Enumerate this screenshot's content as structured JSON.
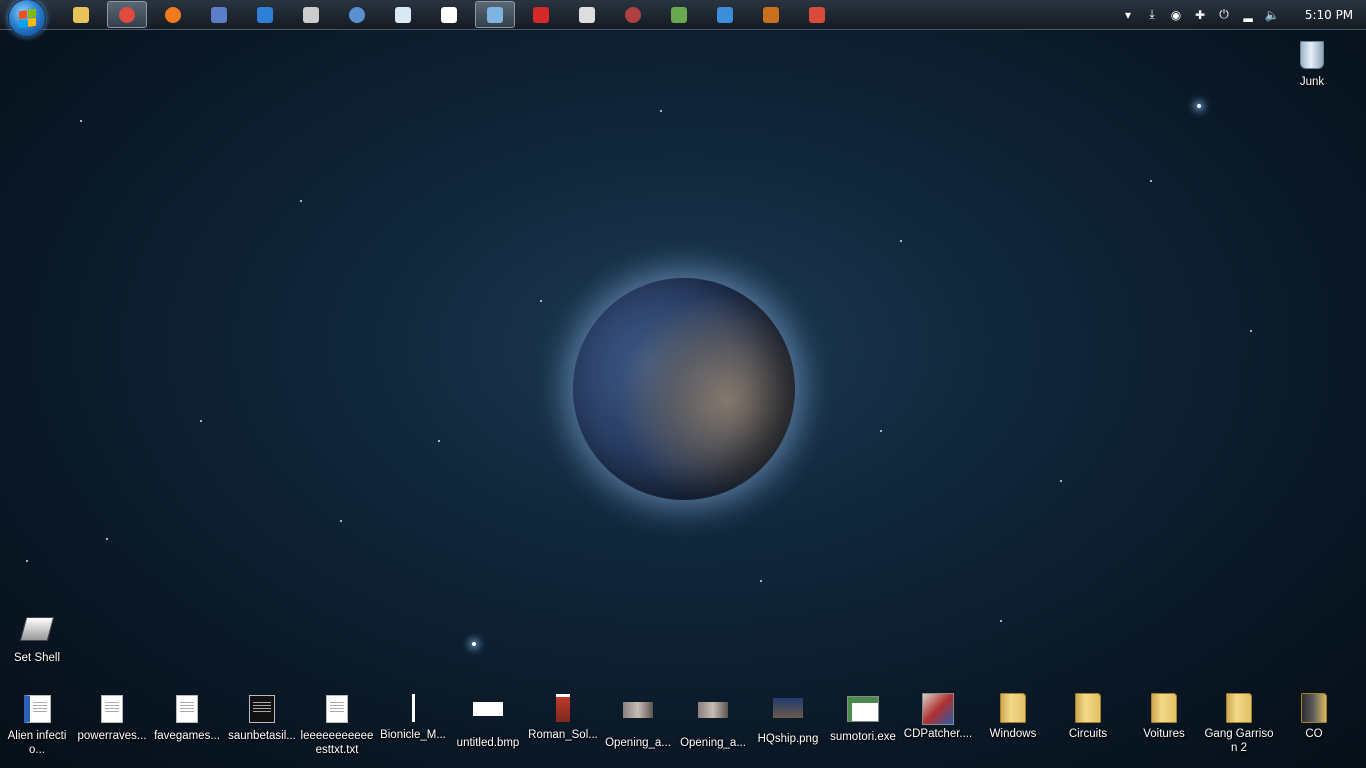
{
  "taskbar": {
    "start_button": "start-orb",
    "pinned": [
      {
        "name": "explorer",
        "color": "#e8c35a",
        "active": false
      },
      {
        "name": "chrome",
        "color": "#e04b3b",
        "active": true
      },
      {
        "name": "firefox",
        "color": "#f07a1e",
        "active": false
      },
      {
        "name": "document-viewer",
        "color": "#5a7fc8",
        "active": false
      },
      {
        "name": "photoshop-elements",
        "color": "#2f7fd6",
        "active": false
      },
      {
        "name": "game",
        "color": "#cccccc",
        "active": false
      },
      {
        "name": "globe",
        "color": "#5a8fd0",
        "active": false
      },
      {
        "name": "notepad",
        "color": "#d9e8f5",
        "active": false
      },
      {
        "name": "wordpad",
        "color": "#ffffff",
        "active": false
      },
      {
        "name": "steam-client",
        "color": "#7fb4e0",
        "active": true
      },
      {
        "name": "red-cross-app",
        "color": "#d62a2a",
        "active": false
      },
      {
        "name": "steam",
        "color": "#dddddd",
        "active": false
      },
      {
        "name": "disc-app",
        "color": "#b04040",
        "active": false
      },
      {
        "name": "minecraft",
        "color": "#6aa84f",
        "active": false
      },
      {
        "name": "3d-box",
        "color": "#3a8fd8",
        "active": false
      },
      {
        "name": "pcd",
        "color": "#c8701e",
        "active": false
      },
      {
        "name": "paint-app",
        "color": "#d84a3a",
        "active": false
      }
    ],
    "tray": [
      {
        "name": "show-hidden-icons",
        "glyph": "▾"
      },
      {
        "name": "download-tray",
        "glyph": "⤓"
      },
      {
        "name": "steam-tray",
        "glyph": "◉"
      },
      {
        "name": "red-cross-tray",
        "glyph": "✚"
      },
      {
        "name": "power-tray",
        "glyph": "⏻"
      },
      {
        "name": "network-tray",
        "glyph": "▂"
      },
      {
        "name": "volume-tray",
        "glyph": "🔈"
      }
    ],
    "clock": "5:10 PM"
  },
  "desktop": {
    "top_right": [
      {
        "label": "Junk",
        "kind": "bin"
      }
    ],
    "left": [
      {
        "label": "Set Shell",
        "kind": "shortcut"
      }
    ],
    "bottom_row": [
      {
        "label": "Alien infectio...",
        "kind": "word-doc"
      },
      {
        "label": "powerraves...",
        "kind": "doc"
      },
      {
        "label": "favegames...",
        "kind": "doc"
      },
      {
        "label": "saunbetasil...",
        "kind": "image-dark"
      },
      {
        "label": "leeeeeeeeeee esttxt.txt",
        "kind": "doc"
      },
      {
        "label": "Bionicle_M...",
        "kind": "image-thin"
      },
      {
        "label": "untitled.bmp",
        "kind": "image-white"
      },
      {
        "label": "Roman_Sol...",
        "kind": "image-soldier"
      },
      {
        "label": "Opening_a...",
        "kind": "image-photo"
      },
      {
        "label": "Opening_a...",
        "kind": "image-photo"
      },
      {
        "label": "HQship.png",
        "kind": "image-ship"
      },
      {
        "label": "sumotori.exe",
        "kind": "exe"
      },
      {
        "label": "CDPatcher....",
        "kind": "exe-cd"
      },
      {
        "label": "Windows",
        "kind": "folder"
      },
      {
        "label": "Circuits",
        "kind": "folder"
      },
      {
        "label": "Voitures",
        "kind": "folder"
      },
      {
        "label": "Gang Garrison 2",
        "kind": "folder"
      },
      {
        "label": "CO",
        "kind": "folder-dark"
      }
    ]
  }
}
